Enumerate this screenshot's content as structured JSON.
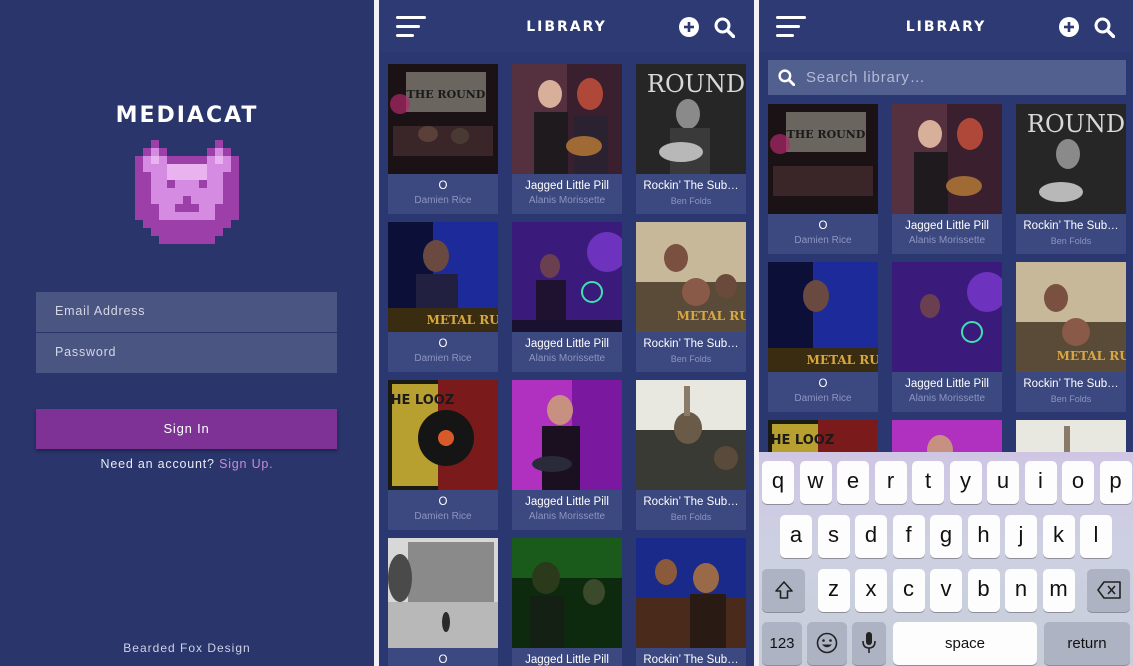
{
  "login": {
    "app_name": "MEDIACAT",
    "email_placeholder": "Email Address",
    "password_placeholder": "Password",
    "signin_label": "Sign In",
    "signup_prompt": "Need an account?",
    "signup_link": "Sign Up.",
    "credit": "Bearded Fox Design"
  },
  "library": {
    "title": "LIBRARY",
    "search_placeholder": "Search library…",
    "items": [
      {
        "title": "O",
        "artist": "Damien Rice"
      },
      {
        "title": "Jagged Little Pill",
        "artist": "Alanis Morissette"
      },
      {
        "title": "Rockin’ The Sub…",
        "artist": "Ben Folds"
      }
    ],
    "thumbnail_overlay_texts": [
      "THE ROUND",
      "ROUND",
      "METAL RUI",
      "THE LOOZ"
    ]
  },
  "keyboard": {
    "row1": [
      "q",
      "w",
      "e",
      "r",
      "t",
      "y",
      "u",
      "i",
      "o",
      "p"
    ],
    "row2": [
      "a",
      "s",
      "d",
      "f",
      "g",
      "h",
      "j",
      "k",
      "l"
    ],
    "row3": [
      "z",
      "x",
      "c",
      "v",
      "b",
      "n",
      "m"
    ],
    "numbers_key": "123",
    "space_key": "space",
    "return_key": "return"
  },
  "colors": {
    "background": "#2a3770",
    "accent": "#7e3296",
    "link": "#c989e0",
    "card": "#3c4880"
  }
}
